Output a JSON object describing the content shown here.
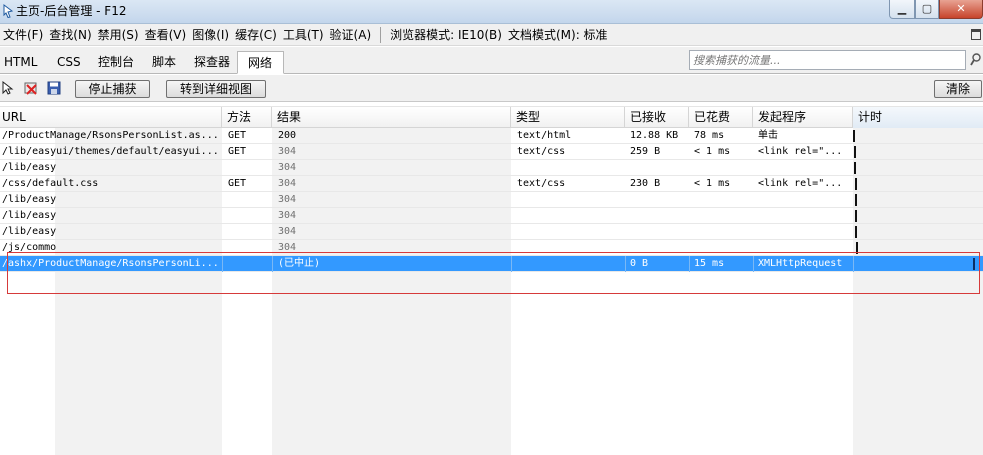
{
  "window": {
    "title": "主页-后台管理 - F12"
  },
  "menu": [
    "文件(F)",
    "查找(N)",
    "禁用(S)",
    "查看(V)",
    "图像(I)",
    "缓存(C)",
    "工具(T)",
    "验证(A)",
    "浏览器模式: IE10(B)",
    "文档模式(M): 标准"
  ],
  "tabs": [
    {
      "label": "HTML",
      "active": false
    },
    {
      "label": "CSS",
      "active": false
    },
    {
      "label": "控制台",
      "active": false
    },
    {
      "label": "脚本",
      "active": false
    },
    {
      "label": "探查器",
      "active": false
    },
    {
      "label": "网络",
      "active": true
    }
  ],
  "search": {
    "placeholder": "搜索捕获的流量..."
  },
  "toolbar": {
    "stop_capture": "停止捕获",
    "detail_view": "转到详细视图",
    "clear": "清除",
    "icons": [
      "cursor-icon",
      "clear-entries-icon",
      "save-icon"
    ]
  },
  "grid": {
    "columns": [
      "URL",
      "方法",
      "结果",
      "类型",
      "已接收",
      "已花费",
      "发起程序",
      "计时"
    ],
    "rows": [
      {
        "url": "/ProductManage/RsonsPersonList.as...",
        "method": "GET",
        "result": "200",
        "type": "text/html",
        "received": "12.88 KB",
        "taken": "78 ms",
        "initiator": "单击"
      },
      {
        "url": "/lib/easyui/themes/default/easyui...",
        "method": "GET",
        "result": "304",
        "type": "text/css",
        "received": "259 B",
        "taken": "< 1 ms",
        "initiator": "<link rel=\"..."
      },
      {
        "url": "/lib/easy",
        "method": "",
        "result": "304",
        "type": "",
        "received": "",
        "taken": "",
        "initiator": ""
      },
      {
        "url": "/css/default.css",
        "method": "GET",
        "result": "304",
        "type": "text/css",
        "received": "230 B",
        "taken": "< 1 ms",
        "initiator": "<link rel=\"..."
      },
      {
        "url": "/lib/easy",
        "method": "",
        "result": "304",
        "type": "",
        "received": "",
        "taken": "",
        "initiator": ""
      },
      {
        "url": "/lib/easy",
        "method": "",
        "result": "304",
        "type": "",
        "received": "",
        "taken": "",
        "initiator": ""
      },
      {
        "url": "/lib/easy",
        "method": "",
        "result": "304",
        "type": "",
        "received": "",
        "taken": "",
        "initiator": ""
      },
      {
        "url": "/js/commo",
        "method": "",
        "result": "304",
        "type": "",
        "received": "",
        "taken": "",
        "initiator": ""
      },
      {
        "url": "/ashx/ProductManage/RsonsPersonLi...",
        "method": "",
        "result": "(已中止)",
        "type": "",
        "received": "0 B",
        "taken": "15 ms",
        "initiator": "XMLHttpRequest",
        "selected": true
      }
    ]
  }
}
